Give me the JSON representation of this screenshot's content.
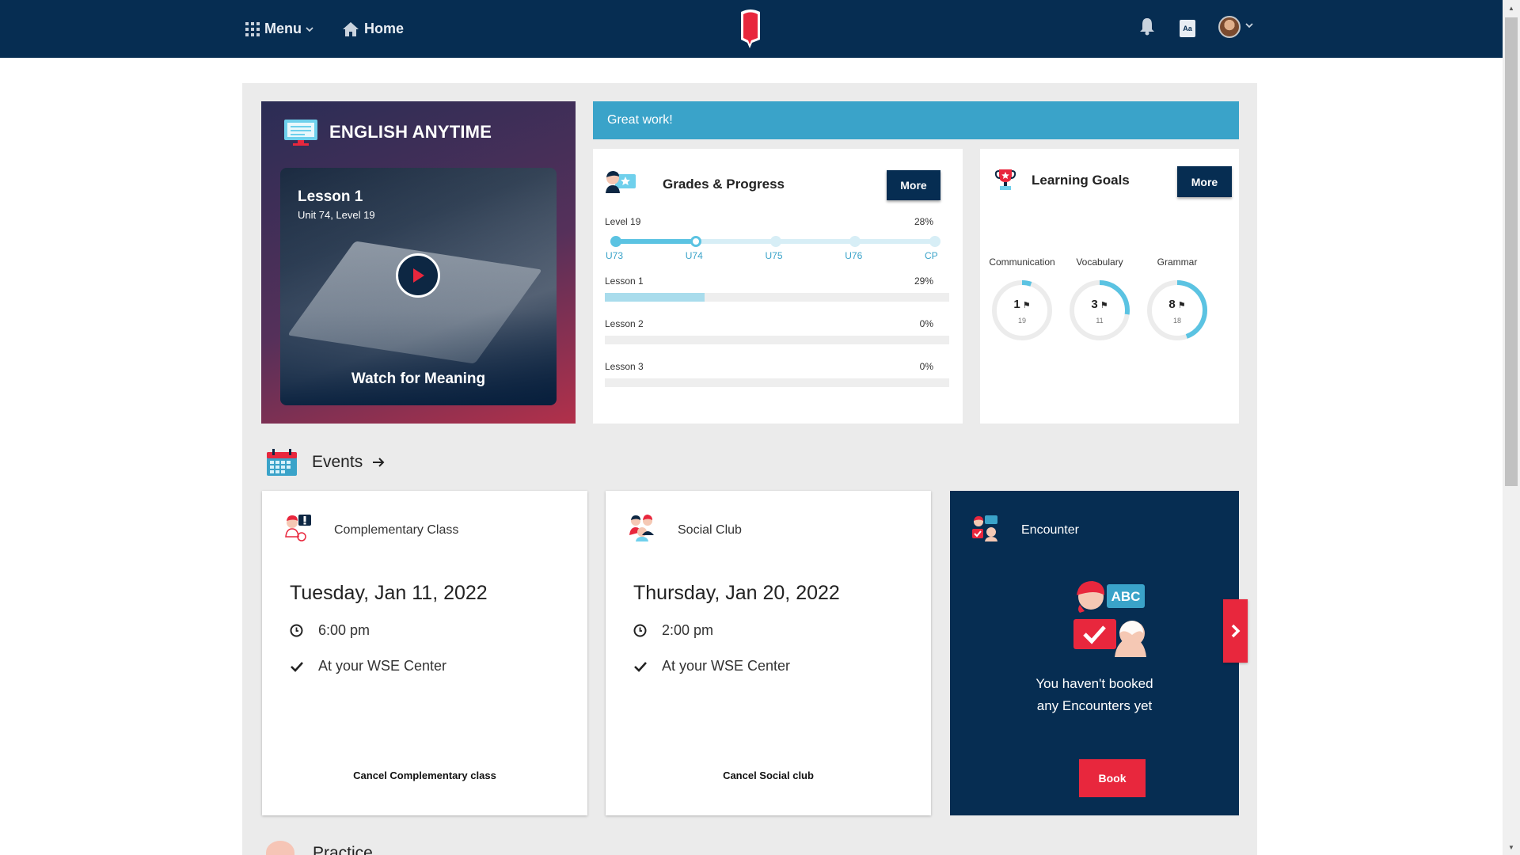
{
  "topbar": {
    "menu_label": "Menu",
    "home_label": "Home",
    "dict_label": "Aa"
  },
  "english_anytime": {
    "title": "ENGLISH ANYTIME",
    "lesson_title": "Lesson 1",
    "lesson_subtitle": "Unit 74, Level 19",
    "caption": "Watch for Meaning"
  },
  "banner": "Great work!",
  "grades": {
    "title": "Grades & Progress",
    "more_label": "More",
    "level_label": "Level 19",
    "level_percent": "28%",
    "level_progress": 0.28,
    "units": [
      "U73",
      "U74",
      "U75",
      "U76",
      "CP"
    ],
    "current_unit_index": 1,
    "lessons": [
      {
        "label": "Lesson 1",
        "percent": "29%",
        "value": 0.29
      },
      {
        "label": "Lesson 2",
        "percent": "0%",
        "value": 0
      },
      {
        "label": "Lesson 3",
        "percent": "0%",
        "value": 0
      }
    ]
  },
  "goals": {
    "title": "Learning Goals",
    "more_label": "More",
    "items": [
      {
        "label": "Communication",
        "value": "1",
        "target": "19"
      },
      {
        "label": "Vocabulary",
        "value": "3",
        "target": "11"
      },
      {
        "label": "Grammar",
        "value": "8",
        "target": "18"
      }
    ]
  },
  "events": {
    "title": "Events",
    "cards": [
      {
        "type": "Complementary Class",
        "date": "Tuesday, Jan 11, 2022",
        "time": "6:00 pm",
        "location": "At your WSE Center",
        "cancel_label": "Cancel Complementary class"
      },
      {
        "type": "Social Club",
        "date": "Thursday, Jan 20, 2022",
        "time": "2:00 pm",
        "location": "At your WSE Center",
        "cancel_label": "Cancel Social club"
      }
    ],
    "encounter": {
      "title": "Encounter",
      "badge_text": "ABC",
      "message_line1": "You haven't booked",
      "message_line2": "any Encounters yet",
      "book_label": "Book"
    }
  },
  "practice": {
    "title": "Practice"
  },
  "colors": {
    "navy": "#062d52",
    "accent_blue": "#3aa3c9",
    "progress": "#5bc3e2",
    "red": "#e8273d"
  }
}
